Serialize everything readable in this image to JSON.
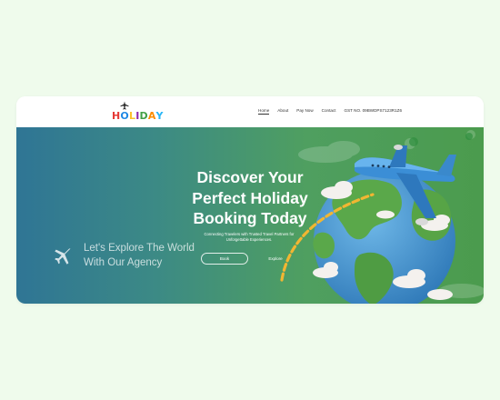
{
  "brand": {
    "logo_letters": [
      "H",
      "O",
      "L",
      "I",
      "D",
      "A",
      "Y"
    ],
    "logo_colors": [
      "#e53935",
      "#1e88e5",
      "#fbc02d",
      "#8e24aa",
      "#43a047",
      "#fb8c00",
      "#29b6f6"
    ]
  },
  "nav": {
    "items": [
      {
        "label": "Home",
        "active": true
      },
      {
        "label": "About",
        "active": false
      },
      {
        "label": "Pay Now",
        "active": false
      },
      {
        "label": "Contact",
        "active": false
      }
    ],
    "gst": "GST NO. 09BWDPS7123R1Z6"
  },
  "hero": {
    "headline": "Discover Your Perfect Holiday Booking Today",
    "subtext": "Connecting Travelers with Trusted Travel Partners for Unforgettable Experiences.",
    "book_label": "Book",
    "explore_label": "Explore",
    "tagline_line1": "Let's Explore The World",
    "tagline_line2": "With Our Agency"
  },
  "colors": {
    "page_background": "#effbec",
    "hero_gradient_start": "#2f7595",
    "hero_gradient_end": "#4b9b4d"
  }
}
